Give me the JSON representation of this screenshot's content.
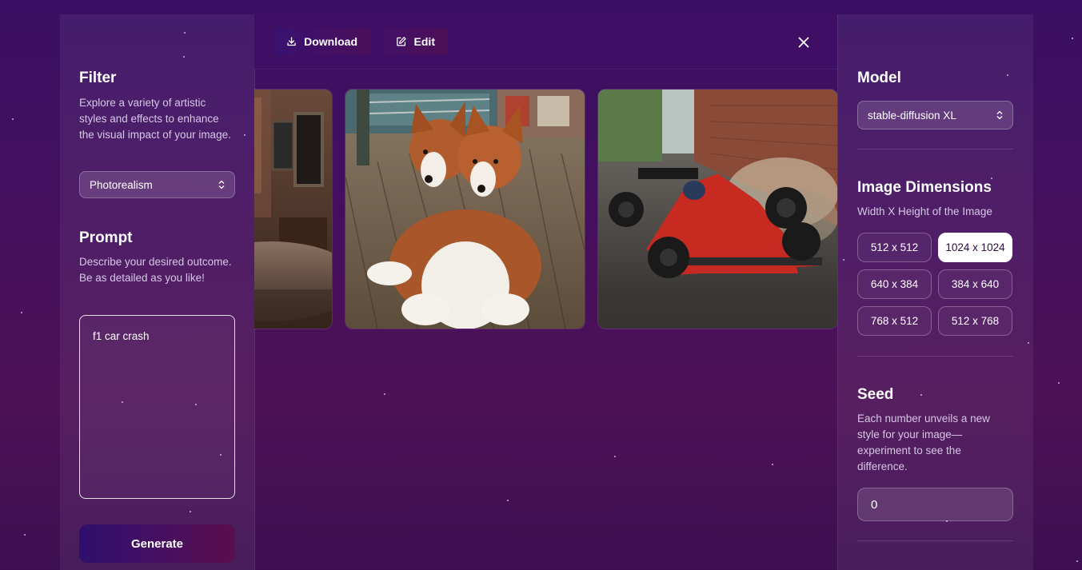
{
  "toolbar": {
    "download_label": "Download",
    "edit_label": "Edit"
  },
  "filter": {
    "title": "Filter",
    "description": "Explore a variety of artistic styles and effects to enhance the visual impact of your image.",
    "selected": "Photorealism"
  },
  "prompt": {
    "title": "Prompt",
    "description": "Describe your desired outcome. Be as detailed as you like!",
    "value": "f1 car crash"
  },
  "generate_label": "Generate",
  "gallery": [
    {
      "description_icon": "cafe-interior-image"
    },
    {
      "description_icon": "two-dogs-image"
    },
    {
      "description_icon": "f1-car-image"
    }
  ],
  "model": {
    "title": "Model",
    "selected": "stable-diffusion XL"
  },
  "dimensions": {
    "title": "Image Dimensions",
    "description": "Width X Height of the Image",
    "options": [
      "512 x 512",
      "1024 x 1024",
      "640 x 384",
      "384 x 640",
      "768 x 512",
      "512 x 768"
    ],
    "selected": "1024 x 1024"
  },
  "seed": {
    "title": "Seed",
    "description": "Each number unveils a new style for your image—experiment to see the difference.",
    "value": "0"
  },
  "colors": {
    "accent": "#3a1170",
    "selected_bg": "#ffffff"
  }
}
